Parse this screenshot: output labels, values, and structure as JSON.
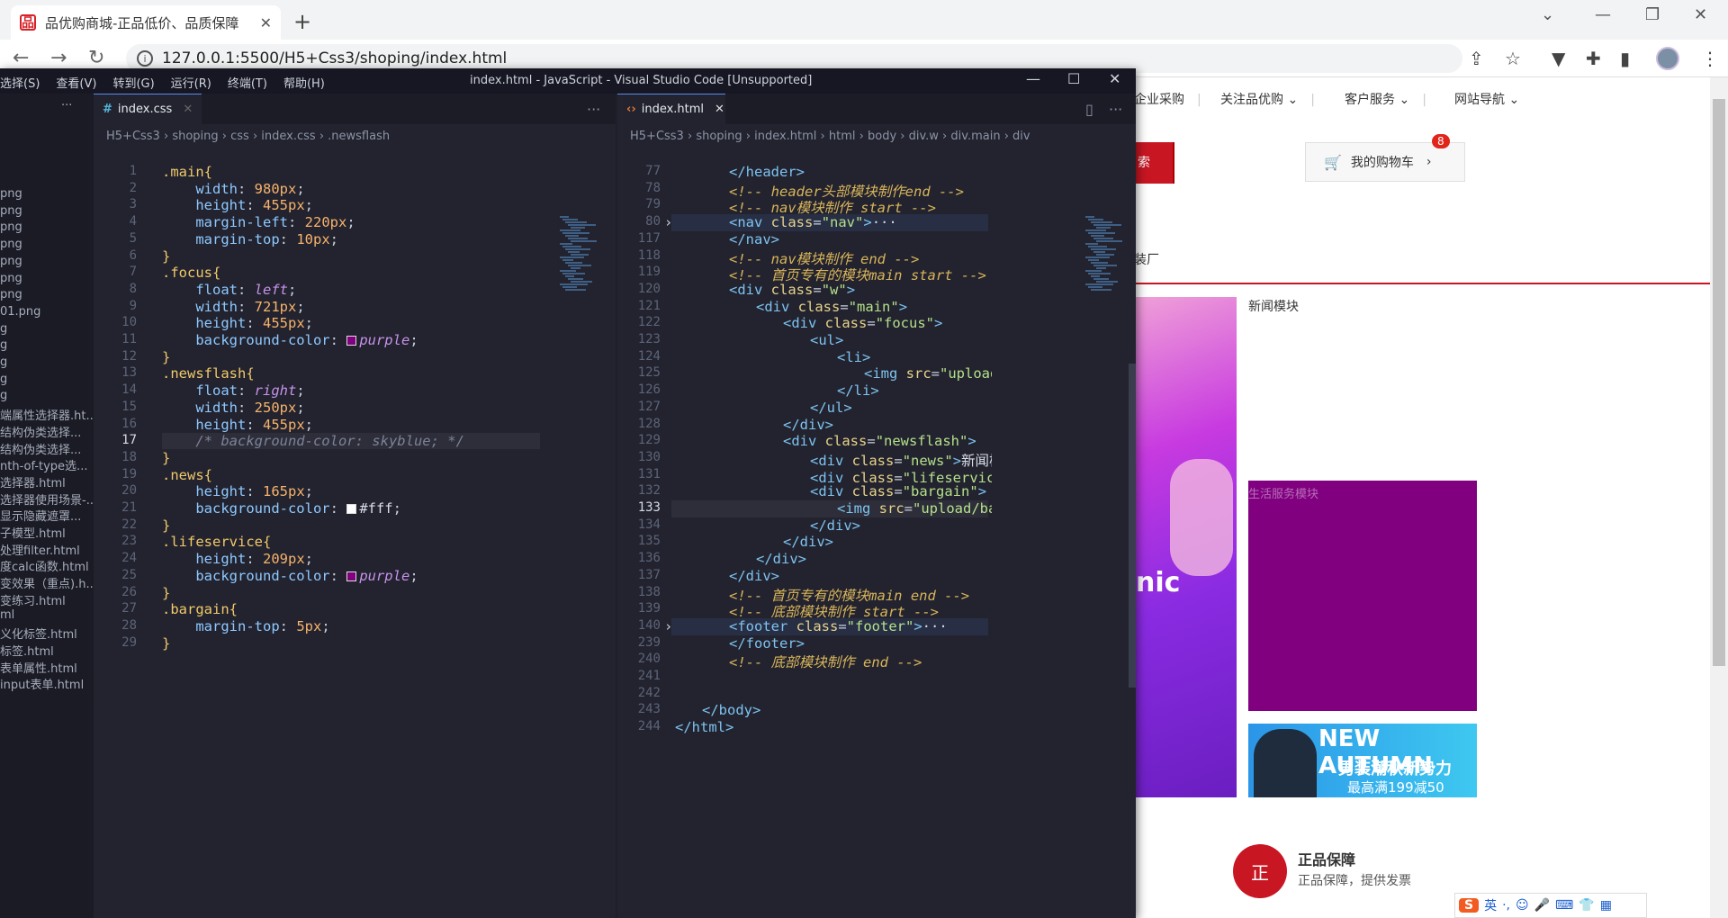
{
  "browser": {
    "tab_title": "品优购商城-正品低价、品质保障",
    "url": "127.0.0.1:5500/H5+Css3/shoping/index.html"
  },
  "webpage": {
    "shortcut_links": [
      "企业采购",
      "关注品优购",
      "客户服务",
      "网站导航"
    ],
    "red_button_fragment": "索",
    "cart_label": "我的购物车",
    "cart_badge": "8",
    "nav_fragment": "装厂",
    "news_title": "新闻模块",
    "lifeservice_label": "生活服务模块",
    "focus_text": "nic",
    "bargain_lines": [
      "NEW AUTUMN",
      "男装潮秋新势力",
      "最高满199减50"
    ],
    "guarantee_icon": "正",
    "guarantee_title": "正品保障",
    "guarantee_sub": "正品保障，提供发票",
    "ime": {
      "logo": "S",
      "mode": "英"
    }
  },
  "vscode": {
    "menu": [
      "选择(S)",
      "查看(V)",
      "转到(G)",
      "运行(R)",
      "终端(T)",
      "帮助(H)"
    ],
    "window_title": "index.html - JavaScript - Visual Studio Code [Unsupported]",
    "explorer_items": [
      "png",
      "png",
      "png",
      "png",
      "png",
      "png",
      "png",
      "01.png",
      "g",
      "g",
      "g",
      "g",
      "g",
      "端属性选择器.ht...",
      "结构伪类选择...",
      "结构伪类选择...",
      "nth-of-type选...",
      "选择器.html",
      "选择器使用场景-...",
      "显示隐藏遮罩...",
      "子模型.html",
      "处理filter.html",
      "度calc函数.html",
      "变效果（重点).h...",
      "变练习.html",
      "ml",
      "义化标签.html",
      "标签.html",
      "表单属性.html",
      "input表单.html"
    ],
    "left_pane": {
      "tab": "index.css",
      "breadcrumb": [
        "H5+Css3",
        "shoping",
        "css",
        "index.css",
        ".newsflash"
      ],
      "line_numbers": [
        "1",
        "2",
        "3",
        "4",
        "5",
        "6",
        "7",
        "8",
        "9",
        "10",
        "11",
        "12",
        "13",
        "14",
        "15",
        "16",
        "17",
        "18",
        "19",
        "20",
        "21",
        "22",
        "23",
        "24",
        "25",
        "26",
        "27",
        "28",
        "29"
      ],
      "current_line": "17"
    },
    "right_pane": {
      "tab": "index.html",
      "breadcrumb": [
        "H5+Css3",
        "shoping",
        "index.html",
        "html",
        "body",
        "div.w",
        "div.main",
        "div"
      ],
      "line_numbers": [
        "77",
        "78",
        "79",
        "80",
        "117",
        "118",
        "119",
        "120",
        "121",
        "122",
        "123",
        "124",
        "125",
        "126",
        "127",
        "128",
        "129",
        "130",
        "131",
        "132",
        "133",
        "134",
        "135",
        "136",
        "137",
        "138",
        "139",
        "140",
        "239",
        "240",
        "241",
        "242",
        "243",
        "244"
      ],
      "current_line": "133"
    }
  },
  "colors": {
    "accent_red": "#c81623",
    "purple": "#800080",
    "editor_bg": "#22232f"
  }
}
